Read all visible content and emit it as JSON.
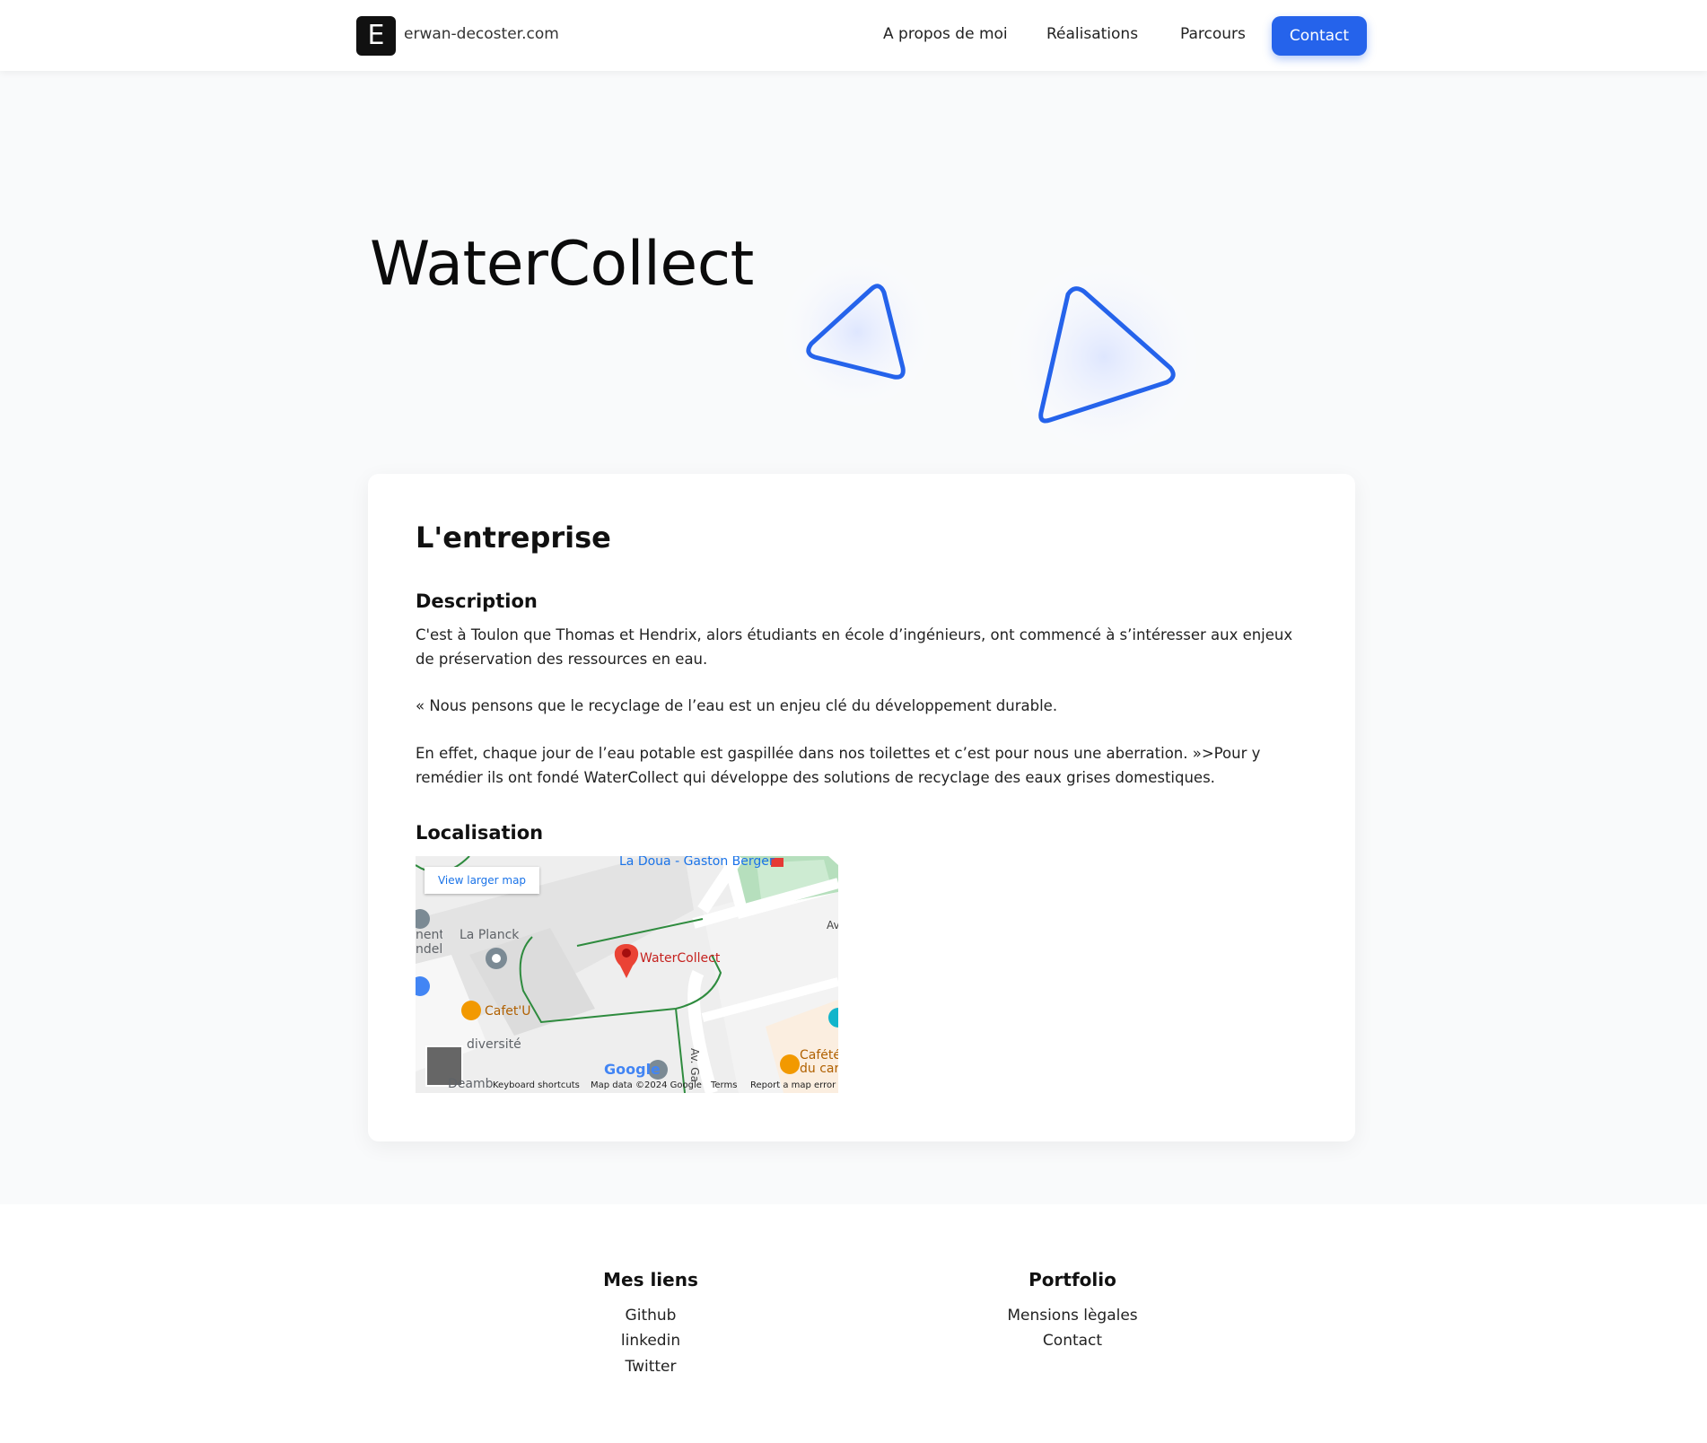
{
  "header": {
    "logo_letter": "E",
    "site_name": "erwan-decoster.com",
    "nav": [
      "A propos de moi",
      "Réalisations",
      "Parcours"
    ],
    "contact_label": "Contact"
  },
  "hero": {
    "title": "WaterCollect"
  },
  "card": {
    "title": "L'entreprise",
    "description_title": "Description",
    "paragraphs": [
      "C'est à Toulon que Thomas et Hendrix, alors étudiants en école d’ingénieurs, ont commencé à s’intéresser aux enjeux de préservation des ressources en eau.",
      "« Nous pensons que le recyclage de l’eau est un enjeu clé du développement durable.",
      "En effet, chaque jour de l’eau potable est gaspillée dans nos toilettes et c’est pour nous une aberration. »>Pour y remédier ils ont fondé WaterCollect qui développe des solutions de recyclage des eaux grises domestiques."
    ],
    "location_title": "Localisation",
    "map": {
      "view_larger": "View larger map",
      "station": "La Doua - Gaston Berger",
      "pin_label": "WaterCollect",
      "place_1": "La Planck",
      "place_2": "Cafet'U",
      "place_3": "diversité",
      "place_4": "Cafété du car",
      "place_5": "nent ndel",
      "place_6": "Deamb",
      "street_1": "Av. Ga",
      "street_2": "Av",
      "google": "Google",
      "footer_shortcuts": "Keyboard shortcuts",
      "footer_data": "Map data ©2024 Google",
      "footer_terms": "Terms",
      "footer_report": "Report a map error"
    }
  },
  "footer": {
    "col1_title": "Mes liens",
    "col1_links": [
      "Github",
      "linkedin",
      "Twitter"
    ],
    "col2_title": "Portfolio",
    "col2_links": [
      "Mensions lègales",
      "Contact"
    ]
  },
  "colors": {
    "accent": "#2563eb",
    "text": "#111111",
    "background": "#f9fafb"
  }
}
